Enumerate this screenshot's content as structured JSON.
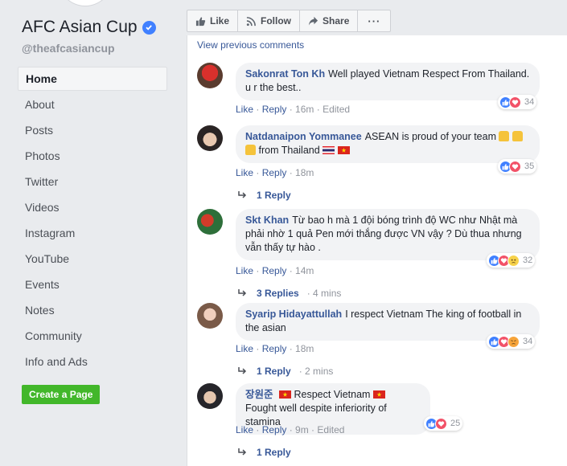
{
  "page": {
    "name": "AFC Asian Cup",
    "handle": "@theafcasiancup"
  },
  "sidebar": {
    "items": [
      {
        "label": "Home",
        "active": true
      },
      {
        "label": "About"
      },
      {
        "label": "Posts"
      },
      {
        "label": "Photos"
      },
      {
        "label": "Twitter"
      },
      {
        "label": "Videos"
      },
      {
        "label": "Instagram"
      },
      {
        "label": "YouTube"
      },
      {
        "label": "Events"
      },
      {
        "label": "Notes"
      },
      {
        "label": "Community"
      },
      {
        "label": "Info and Ads"
      }
    ],
    "create_page": "Create a Page"
  },
  "actions": {
    "like": "Like",
    "follow": "Follow",
    "share": "Share",
    "more": "···"
  },
  "feed": {
    "view_previous": "View previous comments",
    "comments": [
      {
        "author": "Sakonrat Ton Kh",
        "text": "Well played Vietnam Respect From Thailand. u r the best..",
        "like": "Like",
        "reply": "Reply",
        "time": "16m",
        "edited": "Edited",
        "reactions": "34"
      },
      {
        "author": "Natdanaipon Yommanee",
        "text": "ASEAN is proud of your team",
        "text2": "from Thailand",
        "like": "Like",
        "reply": "Reply",
        "time": "18m",
        "reactions": "35",
        "replies": "1 Reply"
      },
      {
        "author": "Skt Khan",
        "text": "Từ bao h mà 1 đội bóng trình độ WC như Nhật mà phải nhờ 1 quả Pen mới thắng được VN vậy ? Dù thua nhưng vẫn thấy tự hào .",
        "like": "Like",
        "reply": "Reply",
        "time": "14m",
        "reactions": "32",
        "replies": "3 Replies",
        "replies_time": "4 mins"
      },
      {
        "author": "Syarip Hidayattullah",
        "text": "I respect Vietnam The king of football in the asian",
        "like": "Like",
        "reply": "Reply",
        "time": "18m",
        "reactions": "34",
        "replies": "1 Reply",
        "replies_time": "2 mins"
      },
      {
        "author": "장원준",
        "text": "Respect Vietnam",
        "text2": "Fought well despite inferiority of stamina",
        "like": "Like",
        "reply": "Reply",
        "time": "9m",
        "edited": "Edited",
        "reactions": "25",
        "replies": "1 Reply"
      }
    ]
  },
  "colors": {
    "link": "#385898",
    "like": "#4080ff",
    "love": "#f25268",
    "create": "#42b72a"
  }
}
